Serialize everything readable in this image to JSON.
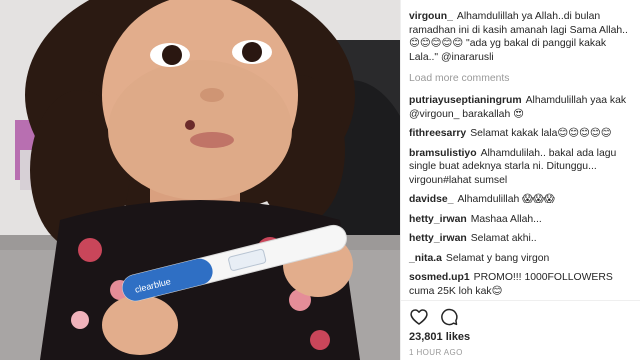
{
  "post": {
    "author": "virgoun_",
    "caption_text": "Alhamdulillah ya Allah..di bulan ramadhan ini di kasih amanah lagi Sama Allah.. 😊😊😊😊😊 \"ada yg bakal di panggil kakak Lala..\" @inararusli",
    "load_more_label": "Load more comments",
    "likes_label": "23,801 likes",
    "time_label": "1 HOUR AGO",
    "test_stick_brand": "clearblue"
  },
  "comments": [
    {
      "user": "putriayuseptianingrum",
      "text": "Alhamdulillah yaa kak @virgoun_ barakallah 😍"
    },
    {
      "user": "fithreesarry",
      "text": "Selamat kakak lala😊😊😊😊😊"
    },
    {
      "user": "bramsulistiyo",
      "text": "Alhamdulilah.. bakal ada lagu single buat adeknya starla ni. Ditunggu... virgoun#lahat sumsel"
    },
    {
      "user": "davidse_",
      "text": "Alhamdulillah 😱😱😱"
    },
    {
      "user": "hetty_irwan",
      "text": "Mashaa Allah..."
    },
    {
      "user": "hetty_irwan",
      "text": "Selamat akhi.."
    },
    {
      "user": "_nita.a",
      "text": "Selamat y bang virgon"
    },
    {
      "user": "sosmed.up1",
      "text": "PROMO!!! 1000FOLLOWERS cuma 25K loh kak😊"
    }
  ],
  "icons": {
    "heart": "heart-icon",
    "comment": "comment-icon"
  },
  "colors": {
    "text": "#262626",
    "muted": "#999999",
    "divider": "#efefef"
  }
}
